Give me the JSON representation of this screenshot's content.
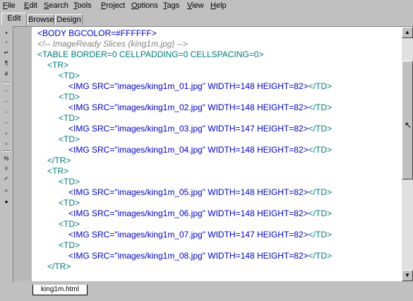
{
  "menu": {
    "items": [
      {
        "label": "File"
      },
      {
        "label": "Edit"
      },
      {
        "label": "Search"
      },
      {
        "label": "Tools"
      },
      {
        "label": "Project"
      },
      {
        "label": "Options"
      },
      {
        "label": "Tags"
      },
      {
        "label": "View"
      },
      {
        "label": "Help"
      }
    ]
  },
  "tabs": [
    {
      "label": "Edit",
      "active": true
    },
    {
      "label": "Browse",
      "active": false
    },
    {
      "label": "Design",
      "active": false
    }
  ],
  "editor": {
    "lines": [
      {
        "indent": 1,
        "parts": [
          {
            "t": "<BODY BGCOLOR=#FFFFFF>",
            "c": "tag"
          }
        ]
      },
      {
        "indent": 1,
        "parts": [
          {
            "t": "<!-- ImageReady Slices (king1m.jpg) -->",
            "c": "comment"
          }
        ]
      },
      {
        "indent": 1,
        "parts": [
          {
            "t": "<TABLE BORDER=0 CELLPADDING=0 CELLSPACING=0>",
            "c": "tag-teal"
          }
        ]
      },
      {
        "indent": 2,
        "parts": [
          {
            "t": "<TR>",
            "c": "tag-teal"
          }
        ]
      },
      {
        "indent": 3,
        "parts": [
          {
            "t": "<TD>",
            "c": "tag-teal"
          }
        ]
      },
      {
        "indent": 4,
        "parts": [
          {
            "t": "<IMG SRC=\"images/king1m_01.jpg\" WIDTH=148 HEIGHT=82>",
            "c": "tag"
          },
          {
            "t": "</TD>",
            "c": "tag-teal"
          }
        ]
      },
      {
        "indent": 3,
        "parts": [
          {
            "t": "<TD>",
            "c": "tag-teal"
          }
        ]
      },
      {
        "indent": 4,
        "parts": [
          {
            "t": "<IMG SRC=\"images/king1m_02.jpg\" WIDTH=148 HEIGHT=82>",
            "c": "tag"
          },
          {
            "t": "</TD>",
            "c": "tag-teal"
          }
        ]
      },
      {
        "indent": 3,
        "parts": [
          {
            "t": "<TD>",
            "c": "tag-teal"
          }
        ]
      },
      {
        "indent": 4,
        "parts": [
          {
            "t": "<IMG SRC=\"images/king1m_03.jpg\" WIDTH=147 HEIGHT=82>",
            "c": "tag"
          },
          {
            "t": "</TD>",
            "c": "tag-teal"
          }
        ]
      },
      {
        "indent": 3,
        "parts": [
          {
            "t": "<TD>",
            "c": "tag-teal"
          }
        ]
      },
      {
        "indent": 4,
        "parts": [
          {
            "t": "<IMG SRC=\"images/king1m_04.jpg\" WIDTH=148 HEIGHT=82>",
            "c": "tag"
          },
          {
            "t": "</TD>",
            "c": "tag-teal"
          }
        ]
      },
      {
        "indent": 2,
        "parts": [
          {
            "t": "</TR>",
            "c": "tag-teal"
          }
        ]
      },
      {
        "indent": 2,
        "parts": [
          {
            "t": "<TR>",
            "c": "tag-teal"
          }
        ]
      },
      {
        "indent": 3,
        "parts": [
          {
            "t": "<TD>",
            "c": "tag-teal"
          }
        ]
      },
      {
        "indent": 4,
        "parts": [
          {
            "t": "<IMG SRC=\"images/king1m_05.jpg\" WIDTH=148 HEIGHT=82>",
            "c": "tag"
          },
          {
            "t": "</TD>",
            "c": "tag-teal"
          }
        ]
      },
      {
        "indent": 3,
        "parts": [
          {
            "t": "<TD>",
            "c": "tag-teal"
          }
        ]
      },
      {
        "indent": 4,
        "parts": [
          {
            "t": "<IMG SRC=\"images/king1m_06.jpg\" WIDTH=148 HEIGHT=82>",
            "c": "tag"
          },
          {
            "t": "</TD>",
            "c": "tag-teal"
          }
        ]
      },
      {
        "indent": 3,
        "parts": [
          {
            "t": "<TD>",
            "c": "tag-teal"
          }
        ]
      },
      {
        "indent": 4,
        "parts": [
          {
            "t": "<IMG SRC=\"images/king1m_07.jpg\" WIDTH=147 HEIGHT=82>",
            "c": "tag"
          },
          {
            "t": "</TD>",
            "c": "tag-teal"
          }
        ]
      },
      {
        "indent": 3,
        "parts": [
          {
            "t": "<TD>",
            "c": "tag-teal"
          }
        ]
      },
      {
        "indent": 4,
        "parts": [
          {
            "t": "<IMG SRC=\"images/king1m_08.jpg\" WIDTH=148 HEIGHT=82>",
            "c": "tag"
          },
          {
            "t": "</TD>",
            "c": "tag-teal"
          }
        ]
      },
      {
        "indent": 2,
        "parts": [
          {
            "t": "</TR>",
            "c": "tag-teal"
          }
        ]
      }
    ]
  },
  "file_tab": {
    "label": "king1m.html"
  },
  "colors": {
    "tag": "#0000c0",
    "tag_teal": "#007a7a",
    "attr": "#800080",
    "comment": "#808080",
    "chrome": "#c0c0c0"
  }
}
